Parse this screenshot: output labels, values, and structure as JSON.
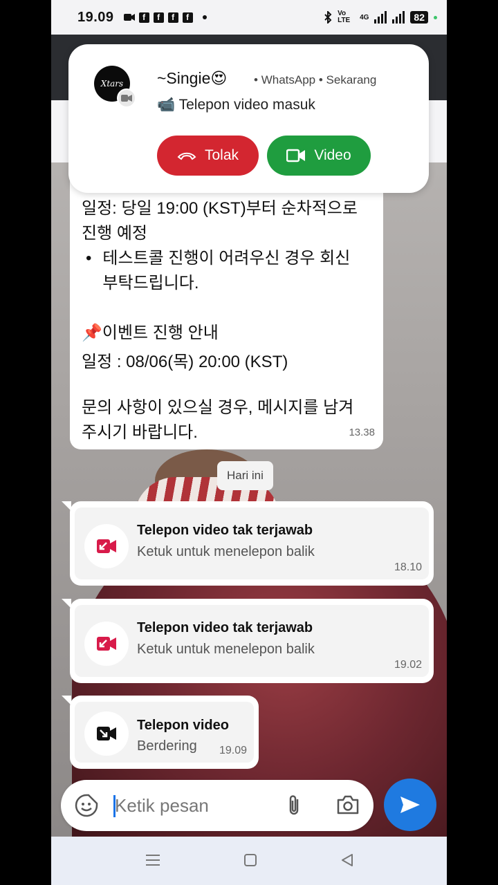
{
  "status_bar": {
    "time": "19.09",
    "notification_icons": [
      "camera-icon",
      "facebook-icon",
      "facebook-icon",
      "facebook-icon",
      "facebook-icon",
      "more-dot"
    ],
    "volte": "Vo LTE",
    "network": "4G",
    "battery": "82"
  },
  "incoming_call": {
    "caller": "~Singie😍",
    "app": "WhatsApp",
    "when": "Sekarang",
    "subtitle": "📹 Telepon video masuk",
    "avatar_text": "Xtars",
    "decline_label": "Tolak",
    "accept_label": "Video",
    "colors": {
      "decline": "#d32630",
      "accept": "#1f9d3f"
    }
  },
  "message": {
    "line1": "일정: 당일 19:00 (KST)부터 순차적으로",
    "line2": "진행 예정",
    "bullet_line1": "테스트콜 진행이 어려우신 경우 회신",
    "bullet_line2": "부탁드립니다.",
    "event_heading": "📌이벤트 진행 안내",
    "event_date": "일정 : 08/06(목) 20:00 (KST)",
    "contact_line1": "문의 사항이 있으실 경우, 메시지를 남겨",
    "contact_line2": "주시기 바랍니다.",
    "time": "13.38"
  },
  "date_chip": "Hari ini",
  "calls": [
    {
      "title": "Telepon video tak terjawab",
      "subtitle": "Ketuk untuk menelepon balik",
      "time": "18.10",
      "icon": "missed-video-call-icon"
    },
    {
      "title": "Telepon video tak terjawab",
      "subtitle": "Ketuk untuk menelepon balik",
      "time": "19.02",
      "icon": "missed-video-call-icon"
    },
    {
      "title": "Telepon video",
      "subtitle": "Berdering",
      "time": "19.09",
      "icon": "outgoing-video-call-icon"
    }
  ],
  "composer": {
    "placeholder": "Ketik pesan"
  },
  "accent": "#1f7ae0",
  "missed_color": "#d81b4a"
}
